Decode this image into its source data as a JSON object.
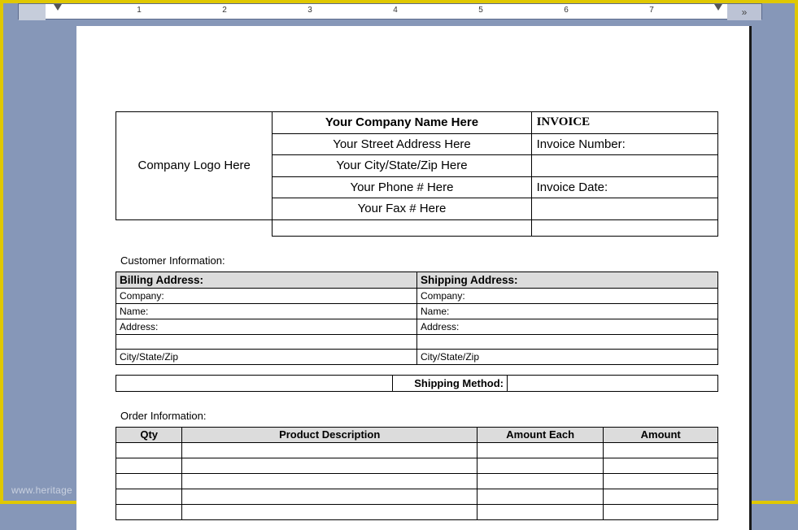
{
  "ruler": {
    "numbers": [
      "1",
      "2",
      "3",
      "4",
      "5",
      "6",
      "7"
    ]
  },
  "company": {
    "logo_placeholder": "Company Logo Here",
    "name": "Your Company Name Here",
    "street": "Your Street Address Here",
    "city": "Your City/State/Zip Here",
    "phone": "Your Phone # Here",
    "fax": "Your Fax # Here"
  },
  "invoice": {
    "title": "INVOICE",
    "number_label": "Invoice Number:",
    "date_label": "Invoice Date:"
  },
  "sections": {
    "customer": "Customer Information:",
    "order": "Order Information:"
  },
  "customer": {
    "billing_header": "Billing Address:",
    "shipping_header": "Shipping Address:",
    "company_label": "Company:",
    "name_label": "Name:",
    "address_label": "Address:",
    "csz_label": "City/State/Zip"
  },
  "shipping": {
    "method_label": "Shipping Method:"
  },
  "order": {
    "headers": {
      "qty": "Qty",
      "desc": "Product Description",
      "each": "Amount Each",
      "amount": "Amount"
    }
  },
  "watermark": "www.heritage"
}
